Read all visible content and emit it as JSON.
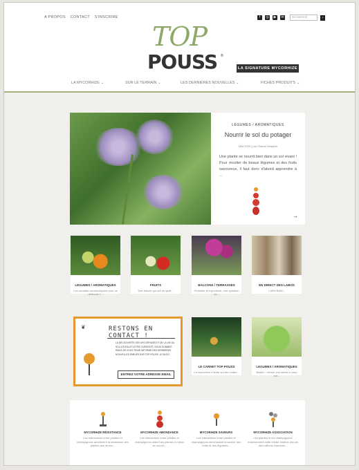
{
  "topnav": {
    "about": "A PROPOS",
    "contact": "CONTACT",
    "subscribe": "S'INSCRIRE"
  },
  "search": {
    "placeholder": "RECHERCHE"
  },
  "logo": {
    "top": "TOP",
    "pouss": "POUSS",
    "reg": "®",
    "tagline": "LA SIGNATURE MYCORHIZE"
  },
  "mainnav": [
    "LA MYCORHIZE ⌄",
    "SUR LE TERRAIN ⌄",
    "LES DERNIÈRES NOUVELLES ⌄",
    "FICHES PRODUITS ⌄"
  ],
  "featured": {
    "category": "LÉGUMES / AROMATIQUES",
    "title": "Nourrir le sol du potager",
    "meta": "MAI 2020 | par Claude Després",
    "excerpt": "Une plante se nourrit bien dans un sol vivant ! Pour récolter de beaux légumes et des fruits savoureux, il faut donc d'abord apprendre à ...",
    "arrow": "→"
  },
  "cards": [
    {
      "title": "LEGUMES / AROMATIQUES",
      "excerpt": "Les tomates communiquent pour se défendre !..."
    },
    {
      "title": "FRUITS",
      "excerpt": "Des fraises qui ont du goût..."
    },
    {
      "title": "BALCONS / TERRASSES",
      "excerpt": "Orchidée et mycorhize, une question de..."
    },
    {
      "title": "EN DIRECT DES LABOS",
      "excerpt": "L'effet BAM..."
    },
    {
      "title": "LE CARNET TOP POUSS",
      "excerpt": "La mycorhize s'invite sur les ondes..."
    },
    {
      "title": "LEGUMES / AROMATIQUES",
      "excerpt": "Basilic : réussir vos semis à coup sûr..."
    }
  ],
  "contact": {
    "title": "RESTONS EN CONTACT !",
    "text": "La découverte des mycorhizes et de la vie du sol a éveillé votre curiosité. Nous sommes ravis de vous tenir informé des dernières nouvelles parues sur Top Pouss. Le blog.",
    "input": "ENTREZ VOTRE ADRESSE EMAIL"
  },
  "bottom": [
    {
      "title": "MYCORHIZE RÉSISTANCE",
      "excerpt": "Les interactions entre plantes et champignons améliorent la résistance des plantes aux stress..."
    },
    {
      "title": "MYCORHIZE ABONDANCE",
      "excerpt": "Les interactions entre plantes et champignons aident les plantes à mieux se nourrir..."
    },
    {
      "title": "MYCORHIZE SAVEURS",
      "excerpt": "Les interactions entre plantes et champignons enrichissent la saveur des fruits et des légumes..."
    },
    {
      "title": "MYCORHIZE ASSOCIATION",
      "excerpt": "Les plantes et les champignons entretiennent cette étroite relation depuis des millions d'années..."
    }
  ],
  "colors": {
    "accent_orange": "#e49a2c",
    "logo_green": "#8ea867",
    "dark": "#333333"
  }
}
